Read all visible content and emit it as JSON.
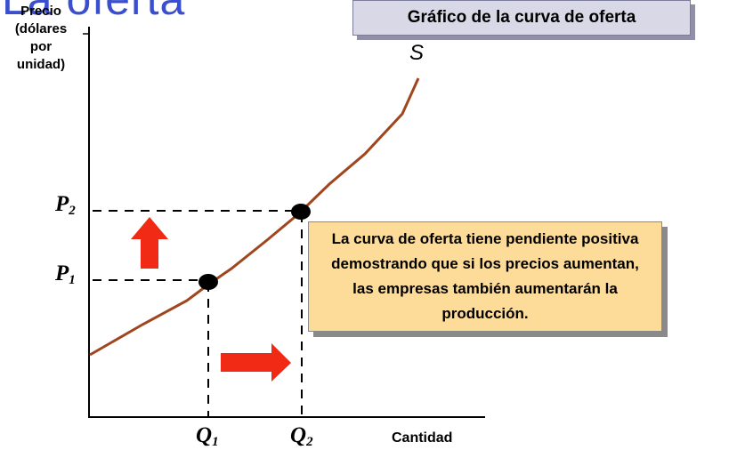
{
  "page_title": "La oferta",
  "chart_title": "Gráfico de la curva de oferta",
  "axes": {
    "y_label_lines": [
      "Precio",
      "(dólares",
      "por",
      "unidad)"
    ],
    "x_label": "Cantidad"
  },
  "curve_label": "S",
  "points": {
    "p1": {
      "letter": "P",
      "sub": "1"
    },
    "p2": {
      "letter": "P",
      "sub": "2"
    },
    "q1": {
      "letter": "Q",
      "sub": "1"
    },
    "q2": {
      "letter": "Q",
      "sub": "2"
    }
  },
  "note": "La curva de oferta tiene pendiente positiva demostrando que si los precios aumentan, las empresas también aumentarán la producción.",
  "colors": {
    "curve": "#a0461e",
    "arrow": "#f02a14",
    "note_bg": "#fddc9a",
    "title_box_bg": "#d8d8e6",
    "page_title": "#3a4fd0"
  },
  "icons": [
    "up-arrow-icon",
    "right-arrow-icon"
  ]
}
